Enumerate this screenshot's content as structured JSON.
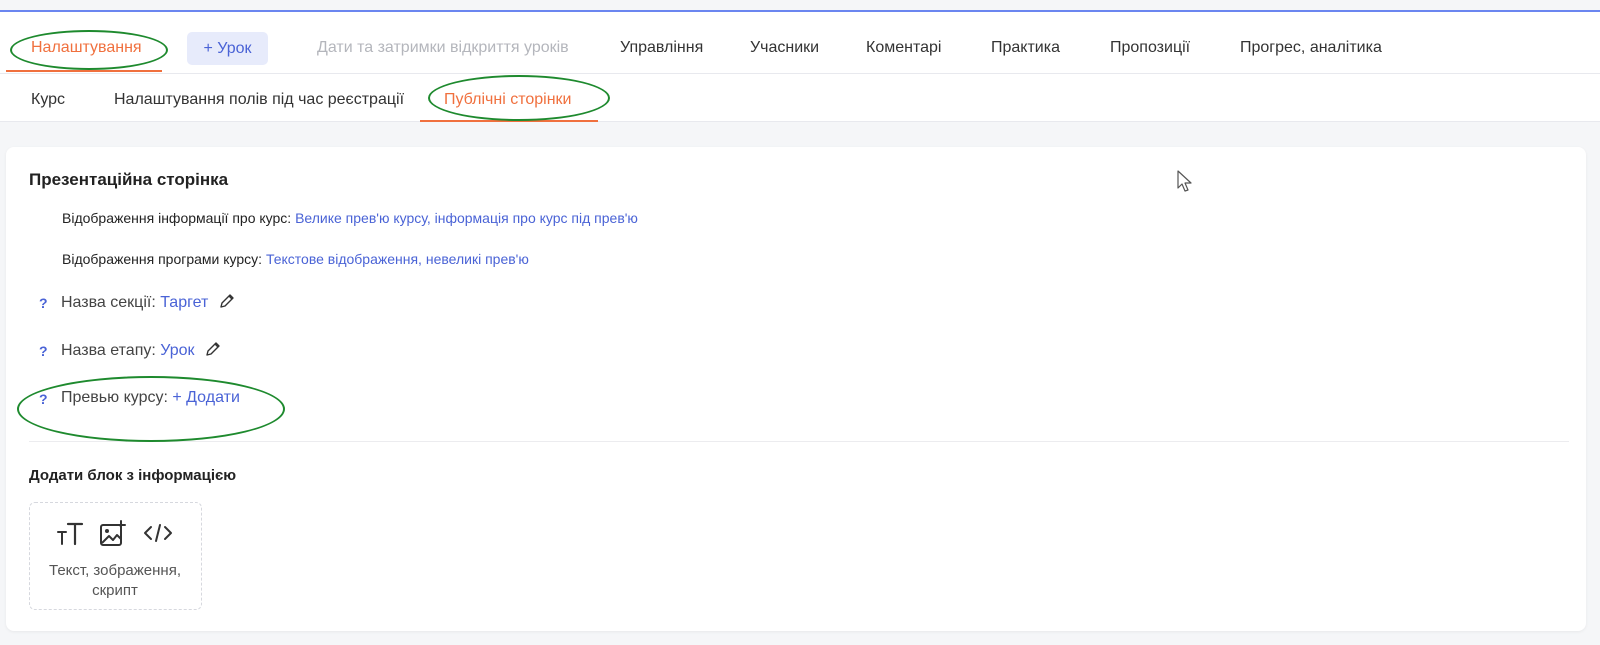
{
  "nav": {
    "tabs": [
      {
        "label": "Налаштування"
      },
      {
        "label": "Дати та затримки відкриття уроків"
      },
      {
        "label": "Управління"
      },
      {
        "label": "Учасники"
      },
      {
        "label": "Коментарі"
      },
      {
        "label": "Практика"
      },
      {
        "label": "Пропозиції"
      },
      {
        "label": "Прогрес, аналітика"
      }
    ],
    "add_lesson": "+ Урок",
    "active_index": 0
  },
  "subnav": {
    "tabs": [
      {
        "label": "Курс"
      },
      {
        "label": "Налаштування полів під час реєстрації"
      },
      {
        "label": "Публічні сторінки"
      }
    ],
    "active_index": 2
  },
  "presentation": {
    "title": "Презентаційна сторінка",
    "info_display": {
      "label": "Відображення інформації про курс:",
      "value": "Велике прев'ю курсу, інформація про курс під прев'ю"
    },
    "program_display": {
      "label": "Відображення програми курсу:",
      "value": "Текстове відображення, невеликі прев'ю"
    },
    "section_name": {
      "help": "?",
      "label": "Назва секції:",
      "value": "Таргет"
    },
    "stage_name": {
      "help": "?",
      "label": "Назва етапу:",
      "value": "Урок"
    },
    "course_preview": {
      "help": "?",
      "label": "Превью курсу:",
      "action": "+ Додати"
    }
  },
  "info_block": {
    "title": "Додати блок з інформацією",
    "label_line1": "Текст, зображення,",
    "label_line2": "скрипт",
    "icons": [
      "text-size-icon",
      "image-add-icon",
      "code-icon"
    ]
  },
  "colors": {
    "accent_orange": "#f0703e",
    "link_blue": "#4a63d6",
    "annotation_green": "#1e8a2e",
    "top_line": "#6b86f0"
  }
}
